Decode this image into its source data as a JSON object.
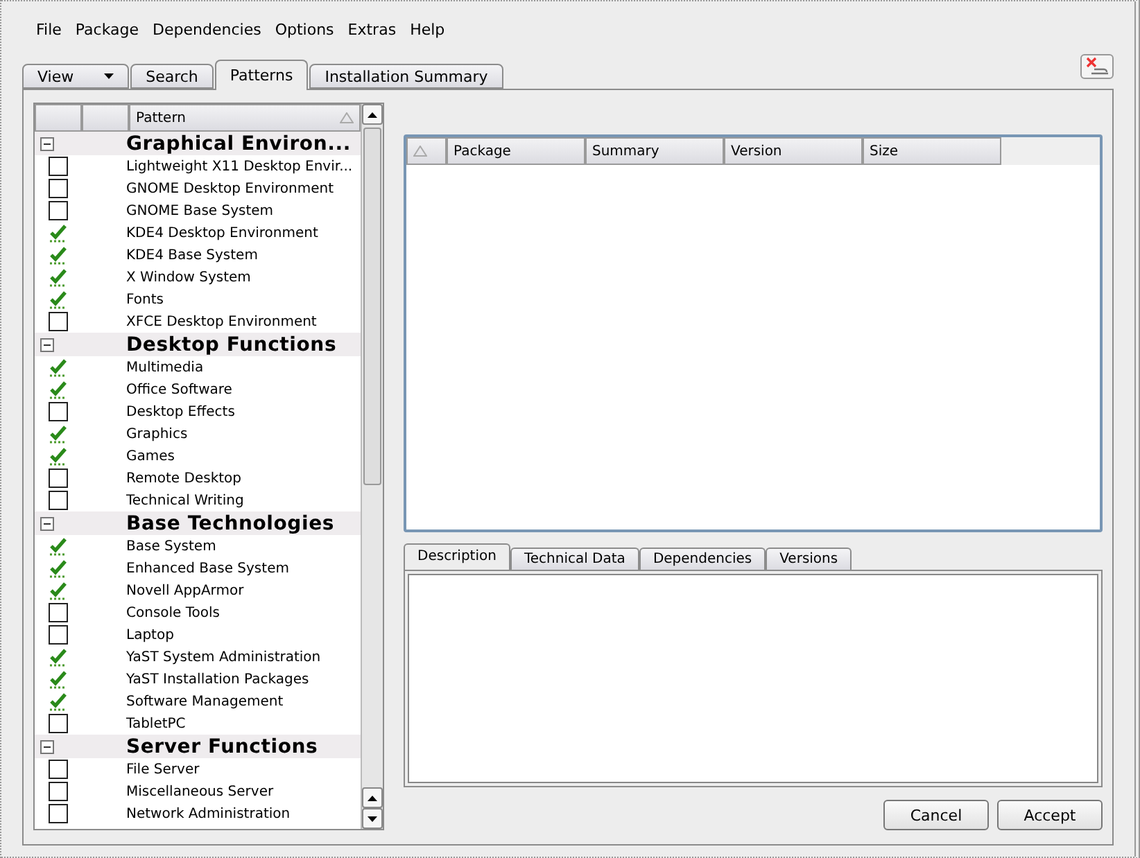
{
  "menu": [
    "File",
    "Package",
    "Dependencies",
    "Options",
    "Extras",
    "Help"
  ],
  "view_tabs": [
    {
      "label": "View",
      "kind": "dropdown",
      "selected": false
    },
    {
      "label": "Search",
      "kind": "tab",
      "selected": false
    },
    {
      "label": "Patterns",
      "kind": "tab",
      "selected": true
    },
    {
      "label": "Installation Summary",
      "kind": "tab",
      "selected": false
    }
  ],
  "patterns": {
    "column": "Pattern",
    "groups": [
      {
        "title": "Graphical Environ...",
        "expanded": true,
        "items": [
          {
            "name": "Lightweight X11 Desktop Envir...",
            "checked": false
          },
          {
            "name": "GNOME Desktop Environment",
            "checked": false
          },
          {
            "name": "GNOME Base System",
            "checked": false
          },
          {
            "name": "KDE4 Desktop Environment",
            "checked": true
          },
          {
            "name": "KDE4 Base System",
            "checked": true
          },
          {
            "name": "X Window System",
            "checked": true
          },
          {
            "name": "Fonts",
            "checked": true
          },
          {
            "name": "XFCE Desktop Environment",
            "checked": false
          }
        ]
      },
      {
        "title": "Desktop Functions",
        "expanded": true,
        "items": [
          {
            "name": "Multimedia",
            "checked": true
          },
          {
            "name": "Office Software",
            "checked": true
          },
          {
            "name": "Desktop Effects",
            "checked": false
          },
          {
            "name": "Graphics",
            "checked": true
          },
          {
            "name": "Games",
            "checked": true
          },
          {
            "name": "Remote Desktop",
            "checked": false
          },
          {
            "name": "Technical Writing",
            "checked": false
          }
        ]
      },
      {
        "title": "Base Technologies",
        "expanded": true,
        "items": [
          {
            "name": "Base System",
            "checked": true
          },
          {
            "name": "Enhanced Base System",
            "checked": true
          },
          {
            "name": "Novell AppArmor",
            "checked": true
          },
          {
            "name": "Console Tools",
            "checked": false
          },
          {
            "name": "Laptop",
            "checked": false
          },
          {
            "name": "YaST System Administration",
            "checked": true
          },
          {
            "name": "YaST Installation Packages",
            "checked": true
          },
          {
            "name": "Software Management",
            "checked": true
          },
          {
            "name": "TabletPC",
            "checked": false
          }
        ]
      },
      {
        "title": "Server Functions",
        "expanded": true,
        "items": [
          {
            "name": "File Server",
            "checked": false
          },
          {
            "name": "Miscellaneous Server",
            "checked": false
          },
          {
            "name": "Network Administration",
            "checked": false
          }
        ]
      }
    ]
  },
  "packages_table": {
    "columns": [
      "Package",
      "Summary",
      "Version",
      "Size"
    ]
  },
  "detail_tabs": [
    {
      "label": "Description",
      "selected": true
    },
    {
      "label": "Technical Data",
      "selected": false
    },
    {
      "label": "Dependencies",
      "selected": false
    },
    {
      "label": "Versions",
      "selected": false
    }
  ],
  "buttons": [
    "Cancel",
    "Accept"
  ]
}
